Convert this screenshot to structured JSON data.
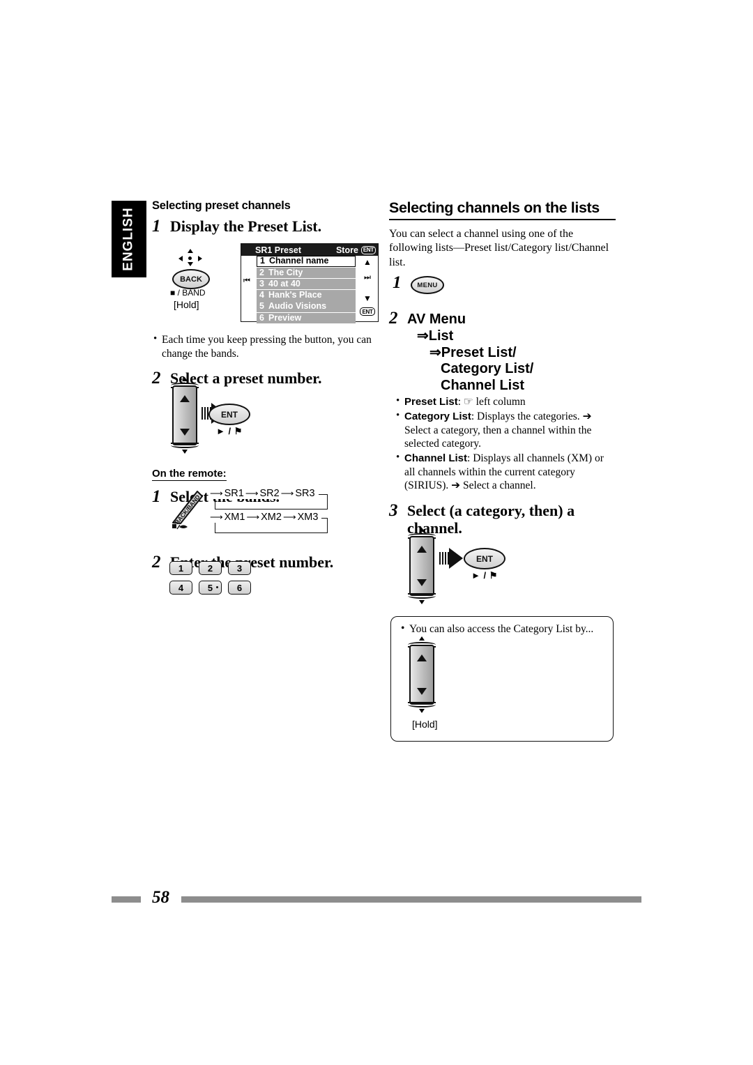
{
  "language_tab": "ENGLISH",
  "left_column": {
    "section_heading": "Selecting preset channels",
    "step1": {
      "num": "1",
      "title": "Display the Preset List.",
      "control": {
        "dpad_icon": "dpad-icon",
        "back_button": "BACK",
        "band_label": "■ / BAND",
        "hold_label": "[Hold]"
      },
      "note": "Each time you keep pressing the button, you can change the bands."
    },
    "lcd": {
      "header_title": "SR1 Preset",
      "header_action": "Store",
      "header_badge": "ENT",
      "rows": [
        {
          "index": "1",
          "name": "Channel name",
          "selected": true
        },
        {
          "index": "2",
          "name": "The City",
          "selected": false
        },
        {
          "index": "3",
          "name": "40 at 40",
          "selected": false
        },
        {
          "index": "4",
          "name": "Hank's Place",
          "selected": false
        },
        {
          "index": "5",
          "name": "Audio Visions",
          "selected": false
        },
        {
          "index": "6",
          "name": "Preview",
          "selected": false
        }
      ],
      "prev_icon": "⏮",
      "next_icon": "⏭",
      "up_icon": "▲",
      "down_icon": "▼",
      "ent_badge": "ENT"
    },
    "step2": {
      "num": "2",
      "title": "Select a preset number.",
      "ent_button": "ENT",
      "ent_sub": "► / ⚑"
    },
    "on_remote_label": "On the remote:",
    "remote_step1": {
      "num": "1",
      "title": "Select the bands.",
      "remote_button": "BACK/BAND",
      "band_sequences": [
        [
          "SR1",
          "SR2",
          "SR3"
        ],
        [
          "XM1",
          "XM2",
          "XM3"
        ]
      ]
    },
    "remote_step2": {
      "num": "2",
      "title": "Enter the preset number.",
      "keys": [
        [
          "1",
          "2",
          "3"
        ],
        [
          "4",
          "5",
          "6"
        ]
      ]
    }
  },
  "right_column": {
    "section_heading": "Selecting channels on the lists",
    "intro": "You can select a channel using one of the following lists—Preset list/Category list/Channel list.",
    "step1": {
      "num": "1",
      "button": "MENU"
    },
    "step2": {
      "num": "2",
      "line1": "AV Menu",
      "line2": "⇒List",
      "line3": "⇒Preset List/",
      "line4": "Category List/",
      "line5": "Channel List",
      "bullets": [
        {
          "term": "Preset List",
          "rest": ": ☞ left column"
        },
        {
          "term": "Category List",
          "rest": ": Displays the categories.",
          "sub": "➔ Select a category, then a channel within the selected category."
        },
        {
          "term": "Channel List",
          "rest": ": Displays all channels (XM) or all channels within the current category (SIRIUS). ➔ Select a channel."
        }
      ]
    },
    "step3": {
      "num": "3",
      "title": "Select (a category, then) a channel.",
      "ent_button": "ENT",
      "ent_sub": "► / ⚑"
    },
    "note_box": {
      "text": "You can also access the Category List by...",
      "hold_label": "[Hold]"
    }
  },
  "footer": {
    "page_number": "58"
  }
}
